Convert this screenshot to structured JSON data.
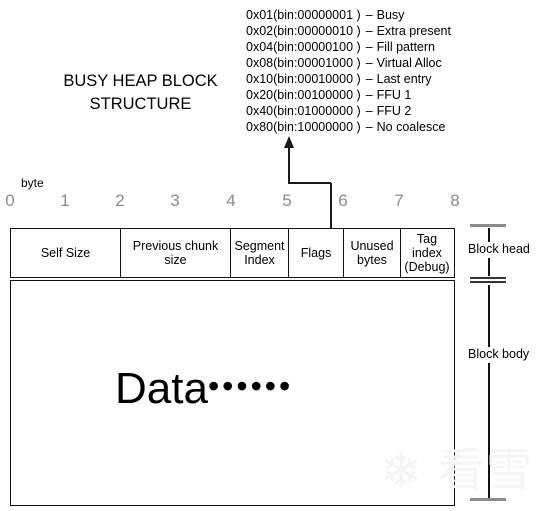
{
  "title": {
    "line1": "BUSY HEAP BLOCK",
    "line2": "STRUCTURE"
  },
  "flag_legend": {
    "rows": [
      {
        "code": "0x01(bin:00000001 )",
        "dash": "–",
        "name": "Busy"
      },
      {
        "code": "0x02(bin:00000010 )",
        "dash": "–",
        "name": "Extra present"
      },
      {
        "code": "0x04(bin:00000100 )",
        "dash": "–",
        "name": "Fill pattern"
      },
      {
        "code": "0x08(bin:00001000 )",
        "dash": "–",
        "name": "Virtual Alloc"
      },
      {
        "code": "0x10(bin:00010000 )",
        "dash": "–",
        "name": "Last entry"
      },
      {
        "code": "0x20(bin:00100000 )",
        "dash": "–",
        "name": "FFU 1"
      },
      {
        "code": "0x40(bin:01000000 )",
        "dash": "–",
        "name": "FFU 2"
      },
      {
        "code": "0x80(bin:10000000 )",
        "dash": "–",
        "name": "No coalesce"
      }
    ]
  },
  "ruler": {
    "unit_label": "byte",
    "ticks": [
      "0",
      "1",
      "2",
      "3",
      "4",
      "5",
      "6",
      "7",
      "8"
    ],
    "tick_color": "#8c8c8c"
  },
  "block_head": {
    "cells": [
      {
        "label": "Self Size",
        "bytes": 2
      },
      {
        "label": "Previous chunk size",
        "bytes": 2
      },
      {
        "label": "Segment Index",
        "bytes": 1
      },
      {
        "label": "Flags",
        "bytes": 1
      },
      {
        "label": "Unused bytes",
        "bytes": 1
      },
      {
        "label": "Tag index (Debug)",
        "bytes": 1
      }
    ],
    "cell_lines": [
      [
        "Self Size"
      ],
      [
        "Previous chunk",
        "size"
      ],
      [
        "Segment",
        "Index"
      ],
      [
        "Flags"
      ],
      [
        "Unused",
        "bytes"
      ],
      [
        "Tag",
        "index",
        "(Debug)"
      ]
    ]
  },
  "block_body": {
    "text": "Data",
    "ellipsis": "••••••"
  },
  "measures": {
    "head_label": "Block head",
    "body_label": "Block body"
  },
  "watermark": {
    "snowflake": "❄",
    "text": "看雪"
  }
}
